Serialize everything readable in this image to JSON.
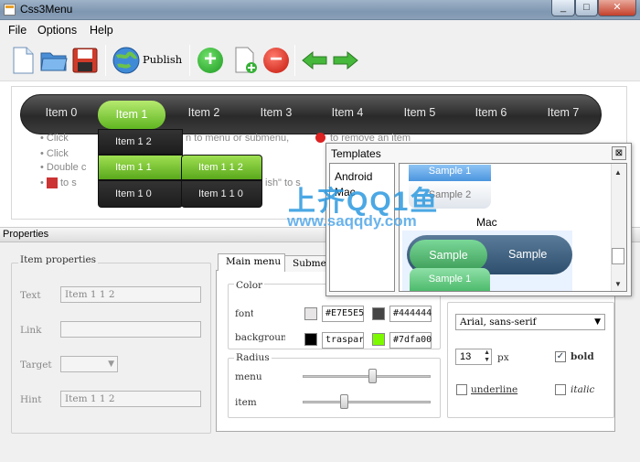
{
  "window": {
    "title": "Css3Menu",
    "min": "_",
    "max": "□",
    "close": "✕"
  },
  "menubar": [
    "File",
    "Options",
    "Help"
  ],
  "toolbar": {
    "publish": "Publish",
    "icons": [
      "new-file-icon",
      "open-folder-icon",
      "save-icon",
      "globe-icon",
      "add-icon",
      "add-page-icon",
      "remove-icon",
      "arrow-left-icon",
      "arrow-right-icon"
    ]
  },
  "preview": {
    "menu_items": [
      "Item 0",
      "Item 1",
      "Item 2",
      "Item 3",
      "Item 4",
      "Item 5",
      "Item 6",
      "Item 7"
    ],
    "submenu": [
      "Item 1 2",
      "Item 1 1",
      "Item 1 0"
    ],
    "subsubmenu": [
      "Item 1 1 2",
      "Item 1 1 0"
    ],
    "hints": [
      "Click",
      "n to menu or submenu,",
      "to remove an item",
      "Click",
      "Double c",
      "to s",
      "ish\" to s"
    ]
  },
  "properties": {
    "header": "Properties",
    "item_props": "Item properties",
    "text_label": "Text",
    "text_value": "Item 1 1 2",
    "link_label": "Link",
    "link_value": "",
    "target_label": "Target",
    "target_value": "",
    "hint_label": "Hint",
    "hint_value": "Item 1 1 2"
  },
  "tabs": {
    "main": "Main menu",
    "sub": "Submenu"
  },
  "color": {
    "label": "Color",
    "font_label": "font",
    "bg_label": "background",
    "font_hex1": "#E7E5E5",
    "font_hex2": "#444444",
    "bg_hex1": "traspar",
    "bg_hex2": "#7dfa00",
    "swatch_font1": "#e7e5e5",
    "swatch_font2": "#444444",
    "swatch_bg1": "#000000",
    "swatch_bg2": "#7dfa00"
  },
  "radius": {
    "label": "Radius",
    "menu_label": "menu",
    "item_label": "item",
    "menu_level": 0.55,
    "item_level": 0.33
  },
  "font": {
    "family": "Arial, sans-serif",
    "size": "13",
    "unit": "px",
    "bold": "bold",
    "underline": "underline",
    "italic": "italic"
  },
  "templates": {
    "title": "Templates",
    "list": [
      "Android",
      "Mac"
    ],
    "section": "Mac",
    "samples": [
      "Sample 1",
      "Sample 2",
      "Sample",
      "Sample",
      "Sample 1"
    ]
  },
  "watermark": {
    "line1": "上齐QQ1鱼",
    "line2": "www.saqqdy.com"
  },
  "colors": {
    "menu_green": "#7dc52e",
    "menu_dark": "#333333",
    "titlebar": "#8aa0b8"
  }
}
